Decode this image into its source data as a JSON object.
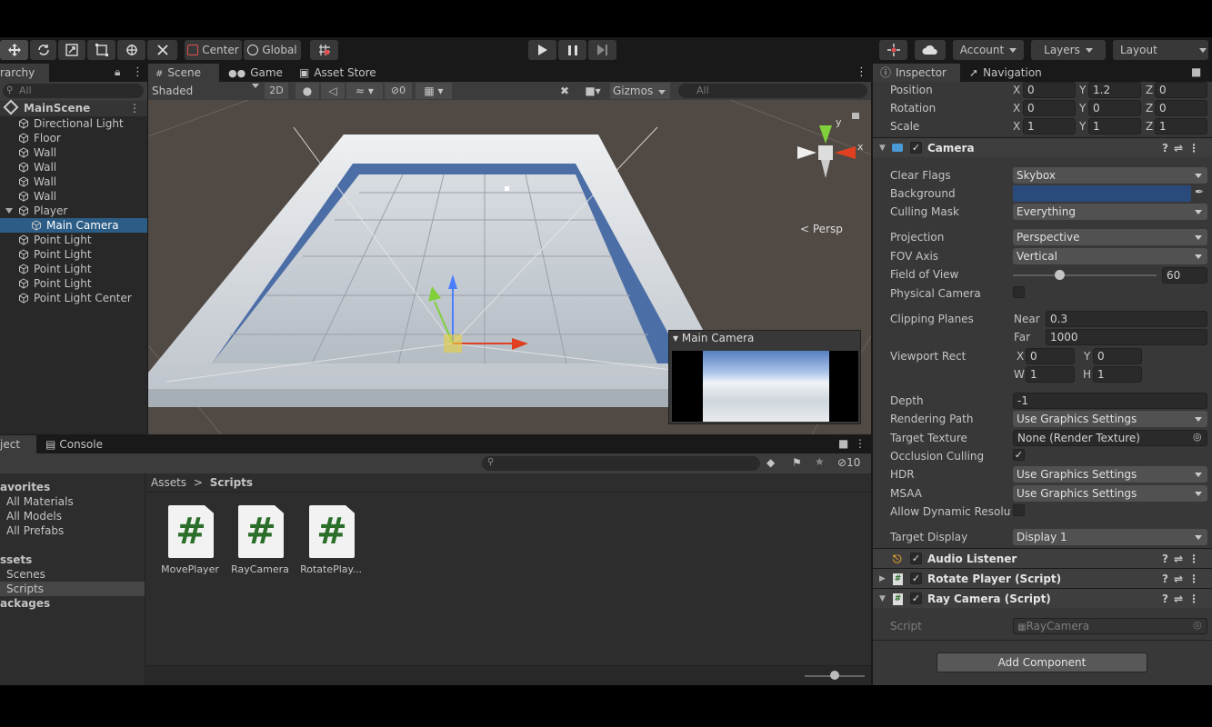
{
  "toolbar": {
    "center_label": "Center",
    "global_label": "Global",
    "account_label": "Account",
    "layers_label": "Layers",
    "layout_label": "Layout"
  },
  "hierarchy": {
    "tab_label": "rarchy",
    "search_placeholder": "All",
    "scene_name": "MainScene",
    "items": [
      {
        "label": "Directional Light"
      },
      {
        "label": "Floor"
      },
      {
        "label": "Wall"
      },
      {
        "label": "Wall"
      },
      {
        "label": "Wall"
      },
      {
        "label": "Wall"
      },
      {
        "label": "Player"
      },
      {
        "label": "Main Camera"
      },
      {
        "label": "Point Light"
      },
      {
        "label": "Point Light"
      },
      {
        "label": "Point Light"
      },
      {
        "label": "Point Light"
      },
      {
        "label": "Point Light Center"
      }
    ]
  },
  "scene_view": {
    "tabs": [
      {
        "label": "Scene"
      },
      {
        "label": "Game"
      },
      {
        "label": "Asset Store"
      }
    ],
    "shading_mode": "Shaded",
    "mode_2d": "2D",
    "hidden_count": "0",
    "gizmos_label": "Gizmos",
    "search_placeholder": "All",
    "persp_label": "Persp",
    "camera_preview_title": "Main Camera"
  },
  "project": {
    "tabs": [
      {
        "label": "ject"
      },
      {
        "label": "Console"
      }
    ],
    "badge_count": "10",
    "favorites_label": "avorites",
    "favorites": [
      {
        "label": "All Materials"
      },
      {
        "label": "All Models"
      },
      {
        "label": "All Prefabs"
      }
    ],
    "assets_label": "ssets",
    "asset_folders": [
      {
        "label": "Scenes"
      },
      {
        "label": "Scripts"
      }
    ],
    "packages_label": "ackages",
    "breadcrumb_root": "Assets",
    "breadcrumb_current": "Scripts",
    "files": [
      {
        "name": "MovePlayer"
      },
      {
        "name": "RayCamera"
      },
      {
        "name": "RotatePlay..."
      }
    ]
  },
  "inspector": {
    "tabs": [
      {
        "label": "Inspector"
      },
      {
        "label": "Navigation"
      }
    ],
    "transform": {
      "position_label": "Position",
      "pos_x": "0",
      "pos_y": "1.2",
      "pos_z": "0",
      "rotation_label": "Rotation",
      "rot_x": "0",
      "rot_y": "0",
      "rot_z": "0",
      "scale_label": "Scale",
      "scale_x": "1",
      "scale_y": "1",
      "scale_z": "1"
    },
    "camera": {
      "title": "Camera",
      "clear_flags_label": "Clear Flags",
      "clear_flags": "Skybox",
      "background_label": "Background",
      "background_color": "#2b4a7c",
      "culling_mask_label": "Culling Mask",
      "culling_mask": "Everything",
      "projection_label": "Projection",
      "projection": "Perspective",
      "fov_axis_label": "FOV Axis",
      "fov_axis": "Vertical",
      "fov_label": "Field of View",
      "fov_value": "60",
      "fov_slider_fraction": 0.32,
      "physical_camera_label": "Physical Camera",
      "clipping_planes_label": "Clipping Planes",
      "near_label": "Near",
      "near_value": "0.3",
      "far_label": "Far",
      "far_value": "1000",
      "viewport_rect_label": "Viewport Rect",
      "vp_x": "0",
      "vp_y": "0",
      "vp_w": "1",
      "vp_h": "1",
      "depth_label": "Depth",
      "depth_value": "-1",
      "rendering_path_label": "Rendering Path",
      "rendering_path": "Use Graphics Settings",
      "target_texture_label": "Target Texture",
      "target_texture": "None (Render Texture)",
      "occlusion_culling_label": "Occlusion Culling",
      "hdr_label": "HDR",
      "hdr_value": "Use Graphics Settings",
      "msaa_label": "MSAA",
      "msaa_value": "Use Graphics Settings",
      "dynamic_res_label": "Allow Dynamic Resolut",
      "target_display_label": "Target Display",
      "target_display": "Display 1"
    },
    "audio_listener_title": "Audio Listener",
    "rotate_player_title": "Rotate Player (Script)",
    "ray_camera_title": "Ray Camera (Script)",
    "script_label": "Script",
    "script_value": "RayCamera",
    "add_component_label": "Add Component"
  },
  "colors": {
    "selection": "#2c5d87",
    "accent_blue": "#4c7cc4"
  }
}
